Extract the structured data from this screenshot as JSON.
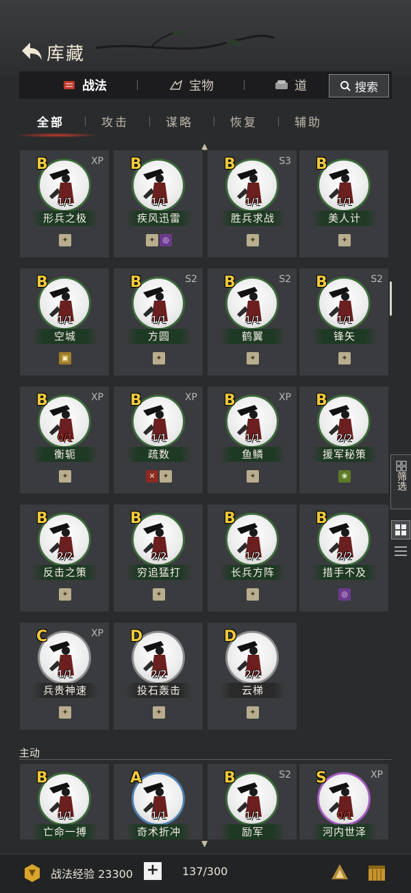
{
  "header": {
    "title": "库藏"
  },
  "main_tabs": [
    {
      "label": "战法",
      "icon": "scroll-icon"
    },
    {
      "label": "宝物",
      "icon": "treasure-icon"
    },
    {
      "label": "道",
      "icon": "item-icon"
    }
  ],
  "search": {
    "label": "搜索"
  },
  "sub_tabs": [
    "全部",
    "攻击",
    "谋略",
    "恢复",
    "辅助"
  ],
  "cards": [
    {
      "grade": "B",
      "tag": "XP",
      "count": "1/1",
      "name": "形兵之极",
      "traits": [
        "tan"
      ]
    },
    {
      "grade": "B",
      "tag": "",
      "count": "1/1",
      "name": "疾风迅雷",
      "traits": [
        "tan",
        "purple"
      ]
    },
    {
      "grade": "B",
      "tag": "S3",
      "count": "1/1",
      "name": "胜兵求战",
      "traits": [
        "tan"
      ]
    },
    {
      "grade": "B",
      "tag": "",
      "count": "1/1",
      "name": "美人计",
      "traits": [
        "tan"
      ]
    },
    {
      "grade": "B",
      "tag": "",
      "count": "1/1",
      "name": "空城",
      "traits": [
        "gold"
      ]
    },
    {
      "grade": "B",
      "tag": "S2",
      "count": "1/1",
      "name": "方圆",
      "traits": [
        "tan"
      ]
    },
    {
      "grade": "B",
      "tag": "S2",
      "count": "1/1",
      "name": "鹤翼",
      "traits": [
        "tan"
      ]
    },
    {
      "grade": "B",
      "tag": "S2",
      "count": "1/1",
      "name": "锋矢",
      "traits": [
        "tan"
      ]
    },
    {
      "grade": "B",
      "tag": "XP",
      "count": "0/1",
      "count_red": true,
      "name": "衡轭",
      "traits": [
        "tan"
      ]
    },
    {
      "grade": "B",
      "tag": "XP",
      "count": "1/1",
      "name": "疏数",
      "traits": [
        "red",
        "tan"
      ]
    },
    {
      "grade": "B",
      "tag": "XP",
      "count": "1/1",
      "name": "鱼鳞",
      "traits": [
        "tan"
      ]
    },
    {
      "grade": "B",
      "tag": "",
      "count": "2/2",
      "name": "援军秘策",
      "traits": [
        "green"
      ]
    },
    {
      "grade": "B",
      "tag": "",
      "count": "2/2",
      "name": "反击之策",
      "traits": [
        "tan"
      ]
    },
    {
      "grade": "B",
      "tag": "",
      "count": "2/2",
      "name": "穷追猛打",
      "traits": [
        "tan"
      ]
    },
    {
      "grade": "B",
      "tag": "",
      "count": "1/2",
      "name": "长兵方阵",
      "traits": [
        "tan"
      ]
    },
    {
      "grade": "B",
      "tag": "",
      "count": "2/2",
      "name": "措手不及",
      "traits": [
        "purple"
      ]
    },
    {
      "grade": "C",
      "tag": "XP",
      "count": "1/1",
      "name": "兵贵神速",
      "traits": [
        "tan"
      ],
      "grey": true
    },
    {
      "grade": "D",
      "tag": "",
      "count": "2/2",
      "name": "投石轰击",
      "traits": [
        "tan"
      ],
      "grey": true
    },
    {
      "grade": "D",
      "tag": "",
      "count": "2/2",
      "name": "云梯",
      "traits": [
        "tan"
      ],
      "grey": true
    }
  ],
  "section_active": {
    "label": "主动"
  },
  "active_cards": [
    {
      "grade": "B",
      "tag": "",
      "count": "1/1",
      "name": "亡命一搏",
      "ring": "green"
    },
    {
      "grade": "A",
      "tag": "",
      "count": "1/1",
      "name": "奇术折冲",
      "ring": "blue"
    },
    {
      "grade": "B",
      "tag": "S2",
      "count": "1/1",
      "name": "励军",
      "ring": "green"
    },
    {
      "grade": "S",
      "tag": "XP",
      "count": "0/1",
      "count_red": true,
      "name": "河内世泽",
      "ring": "purple"
    }
  ],
  "side": {
    "filter_label": "筛选"
  },
  "bottom": {
    "xp_label": "战法经验 23300",
    "plus": "+",
    "capacity": "137/300"
  },
  "colors": {
    "grade": "#f0c93a",
    "accent_red": "#c0392b",
    "name_band": "#1e3a24"
  }
}
